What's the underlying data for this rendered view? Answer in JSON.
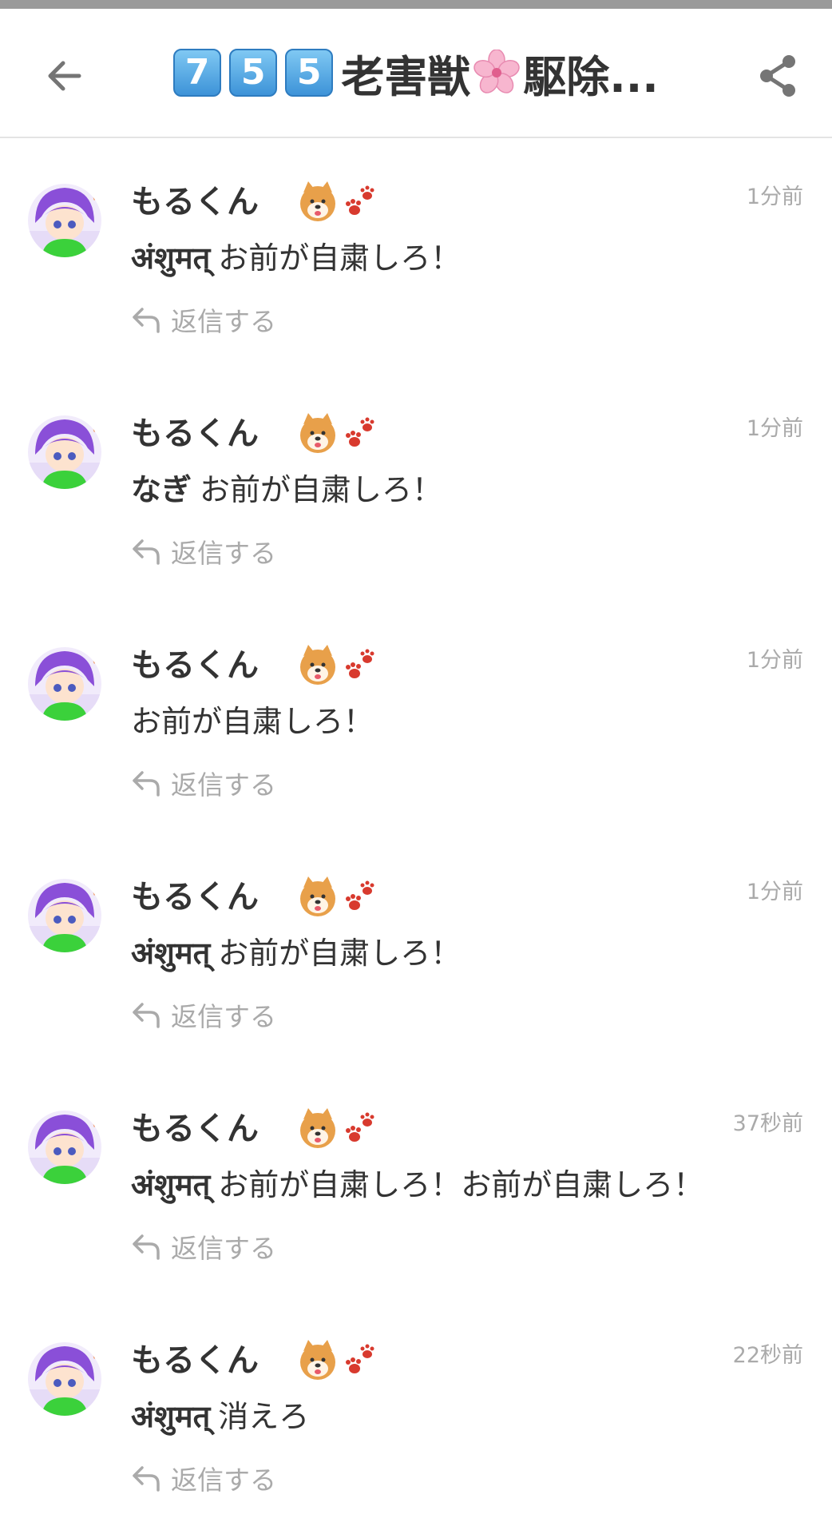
{
  "header": {
    "keycaps": [
      "7",
      "5",
      "5"
    ],
    "title_text": "老害獣",
    "title_suffix": "駆除..."
  },
  "comments": [
    {
      "username": "もるくん",
      "time": "1分前",
      "mention": "अंशुमत्",
      "text": "お前が自粛しろ！",
      "reply_label": "返信する"
    },
    {
      "username": "もるくん",
      "time": "1分前",
      "mention": "なぎ",
      "text": "お前が自粛しろ！",
      "reply_label": "返信する"
    },
    {
      "username": "もるくん",
      "time": "1分前",
      "mention": "",
      "text": "お前が自粛しろ！",
      "reply_label": "返信する"
    },
    {
      "username": "もるくん",
      "time": "1分前",
      "mention": "अंशुमत्",
      "text": "お前が自粛しろ！",
      "reply_label": "返信する"
    },
    {
      "username": "もるくん",
      "time": "37秒前",
      "mention": "अंशुमत्",
      "text": "お前が自粛しろ！お前が自粛しろ！",
      "reply_label": "返信する"
    },
    {
      "username": "もるくん",
      "time": "22秒前",
      "mention": "अंशुमत्",
      "text": "消えろ",
      "reply_label": "返信する"
    }
  ],
  "icons": {
    "back": "arrow-left-icon",
    "share": "share-icon",
    "reply": "reply-arrow-icon",
    "title_emoji": "cherry-blossom-icon",
    "user_emoji": [
      "shiba-dog-icon",
      "paw-prints-icon"
    ]
  },
  "colors": {
    "text": "#333333",
    "muted": "#aaaaaa",
    "keycap": "#3d93d8",
    "avatar_hair": "#8a4fd8",
    "avatar_shirt": "#3bd13b"
  }
}
